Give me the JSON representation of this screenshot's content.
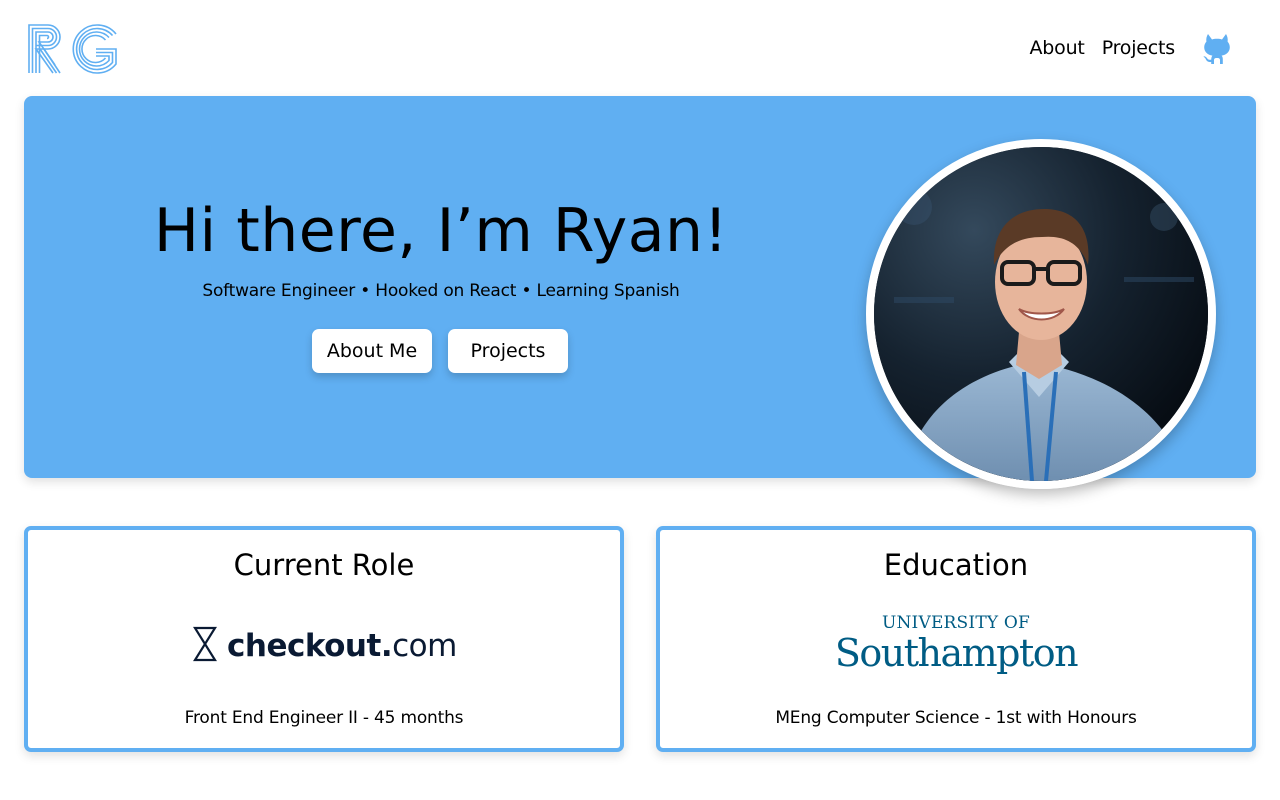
{
  "brand": {
    "logo_text": "RG",
    "accent_color": "#60aff2"
  },
  "nav": {
    "items": [
      {
        "label": "About"
      },
      {
        "label": "Projects"
      }
    ],
    "github_icon": "github-icon"
  },
  "hero": {
    "title": "Hi there, I’m Ryan!",
    "subtitle": "Software Engineer • Hooked on React • Learning Spanish",
    "buttons": [
      {
        "label": "About Me"
      },
      {
        "label": "Projects"
      }
    ],
    "avatar": "profile-photo"
  },
  "cards": [
    {
      "title": "Current Role",
      "logo_text": "checkout.com",
      "description": "Front End Engineer II - 45 months"
    },
    {
      "title": "Education",
      "logo_text_top": "UNIVERSITY OF",
      "logo_text_main": "Southampton",
      "description": "MEng Computer Science - 1st with Honours"
    }
  ]
}
